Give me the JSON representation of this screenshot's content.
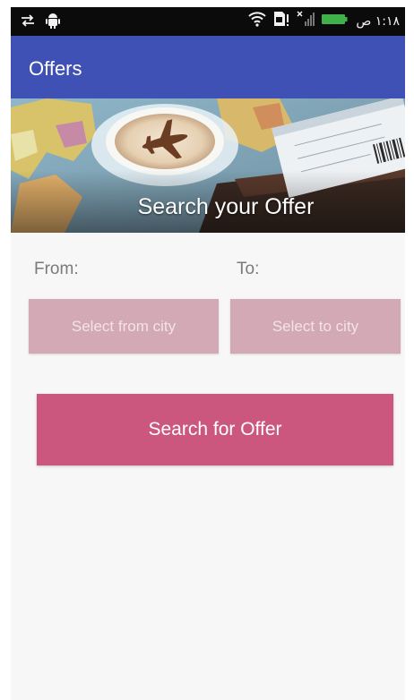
{
  "status_bar": {
    "time": "١:١٨ ص",
    "icons": [
      "sync-icon",
      "android-debug-icon",
      "wifi-icon",
      "sim-icon",
      "signal-icon",
      "battery-icon"
    ]
  },
  "app_bar": {
    "title": "Offers",
    "color": "#3f51b5"
  },
  "banner": {
    "caption": "Search your Offer"
  },
  "form": {
    "from_label": "From:",
    "to_label": "To:",
    "from_button": "Select from city",
    "to_button": "Select to city",
    "city_button_color": "#d3a9b6"
  },
  "search_button": {
    "label": "Search for Offer",
    "color": "#cb567e"
  }
}
